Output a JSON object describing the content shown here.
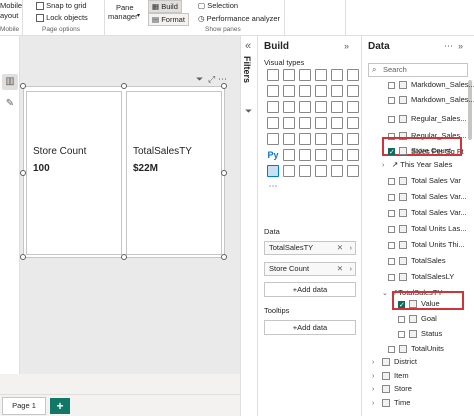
{
  "ribbon": {
    "mobile": "Mobile",
    "layout": "ayout",
    "mobile_group": "Mobile",
    "snap_to_grid": "Snap to grid",
    "lock_objects": "Lock objects",
    "page_options": "Page options",
    "pane": "Pane",
    "manager": "manager",
    "build": "Build",
    "format": "Format",
    "selection": "Selection",
    "performance_analyzer": "Performance analyzer",
    "show_panes": "Show panes"
  },
  "canvas": {
    "cards": [
      {
        "label": "Store Count",
        "value": "100"
      },
      {
        "label": "TotalSalesTY",
        "value": "$22M"
      }
    ]
  },
  "pages": {
    "tab": "Page 1",
    "add": "+"
  },
  "filters": {
    "label": "Filters"
  },
  "build_pane": {
    "title": "Build",
    "visual_types": "Visual types",
    "data_label": "Data",
    "wells": [
      "TotalSalesTY",
      "Store Count"
    ],
    "add_data": "+Add data",
    "tooltips": "Tooltips",
    "add_data_2": "+Add data"
  },
  "data_pane": {
    "title": "Data",
    "search_placeholder": "Search",
    "fields": [
      {
        "label": "Markdown_Sales...",
        "kind": "field"
      },
      {
        "label": "Markdown_Sales...",
        "kind": "field"
      },
      {
        "label": "Regular_Sales...",
        "kind": "field"
      },
      {
        "label": "Regular_Sales...",
        "kind": "field"
      },
      {
        "label": "Sales Per Sq Ft",
        "kind": "field"
      },
      {
        "label": "Store Count",
        "kind": "field",
        "checked": true
      },
      {
        "label": "This Year Sales",
        "kind": "folder"
      },
      {
        "label": "Total Sales Var",
        "kind": "field"
      },
      {
        "label": "Total Sales Var...",
        "kind": "field"
      },
      {
        "label": "Total Sales Var...",
        "kind": "field"
      },
      {
        "label": "Total Units Las...",
        "kind": "field"
      },
      {
        "label": "Total Units Thi...",
        "kind": "field"
      },
      {
        "label": "TotalSales",
        "kind": "field"
      },
      {
        "label": "TotalSalesLY",
        "kind": "field"
      },
      {
        "label": "TotalSalesTY",
        "kind": "kpi"
      },
      {
        "label": "Value",
        "kind": "field",
        "checked": true
      },
      {
        "label": "Goal",
        "kind": "field"
      },
      {
        "label": "Status",
        "kind": "field"
      },
      {
        "label": "TotalUnits",
        "kind": "field"
      },
      {
        "label": "District",
        "kind": "table"
      },
      {
        "label": "Item",
        "kind": "table"
      },
      {
        "label": "Store",
        "kind": "table"
      },
      {
        "label": "Time",
        "kind": "table"
      }
    ]
  },
  "colors": {
    "accent": "#117865",
    "highlight": "#d13438",
    "check": "#0f6a5a"
  }
}
